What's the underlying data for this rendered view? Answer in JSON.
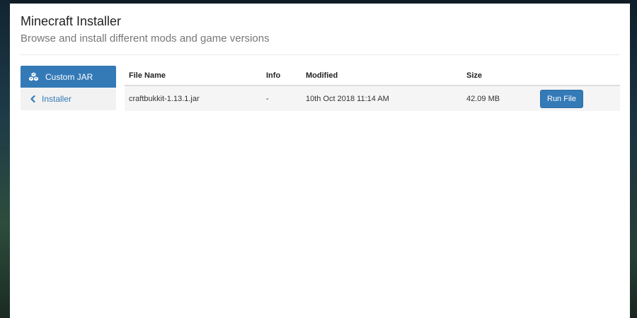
{
  "header": {
    "title": "Minecraft Installer",
    "subtitle": "Browse and install different mods and game versions"
  },
  "sidebar": {
    "items": [
      {
        "label": "Custom JAR",
        "icon": "cubes-icon",
        "active": true
      },
      {
        "label": "Installer",
        "icon": "chevron-left-icon",
        "active": false
      }
    ]
  },
  "table": {
    "columns": [
      "File Name",
      "Info",
      "Modified",
      "Size",
      ""
    ],
    "rows": [
      {
        "file_name": "craftbukkit-1.13.1.jar",
        "info": "-",
        "modified": "10th Oct 2018 11:14 AM",
        "size": "42.09 MB",
        "action_label": "Run File"
      }
    ]
  },
  "colors": {
    "accent": "#337ab7",
    "sidebar_inactive_bg": "#f2f2f2",
    "row_bg": "#f5f5f5"
  }
}
